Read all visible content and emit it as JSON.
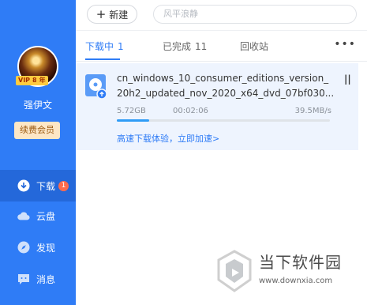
{
  "sidebar": {
    "vip_label": "VIP",
    "vip_level": "8",
    "vip_suffix": "年",
    "username": "强伊文",
    "renew_label": "续费会员",
    "nav": [
      {
        "label": "下载",
        "icon": "download-icon",
        "badge": "1"
      },
      {
        "label": "云盘",
        "icon": "cloud-icon"
      },
      {
        "label": "发现",
        "icon": "compass-icon"
      },
      {
        "label": "消息",
        "icon": "message-icon"
      }
    ]
  },
  "topbar": {
    "new_label": "新建",
    "search_placeholder": "风平浪静"
  },
  "tabs": [
    {
      "label": "下载中",
      "count": "1"
    },
    {
      "label": "已完成",
      "count": "11"
    },
    {
      "label": "回收站",
      "count": ""
    }
  ],
  "download": {
    "filename_line1": "cn_windows_10_consumer_editions_version_",
    "filename_line2": "20h2_updated_nov_2020_x64_dvd_07bf030...",
    "size": "5.72GB",
    "elapsed": "00:02:06",
    "speed": "39.5MB/s",
    "progress": 0.15,
    "accelerate": "高速下载体验，立即加速>"
  },
  "watermark": {
    "title": "当下软件园",
    "url": "www.downxia.com"
  },
  "colors": {
    "sidebar": "#2f7cf6",
    "accent": "#2f7cf6",
    "badge": "#ff6b4d"
  }
}
